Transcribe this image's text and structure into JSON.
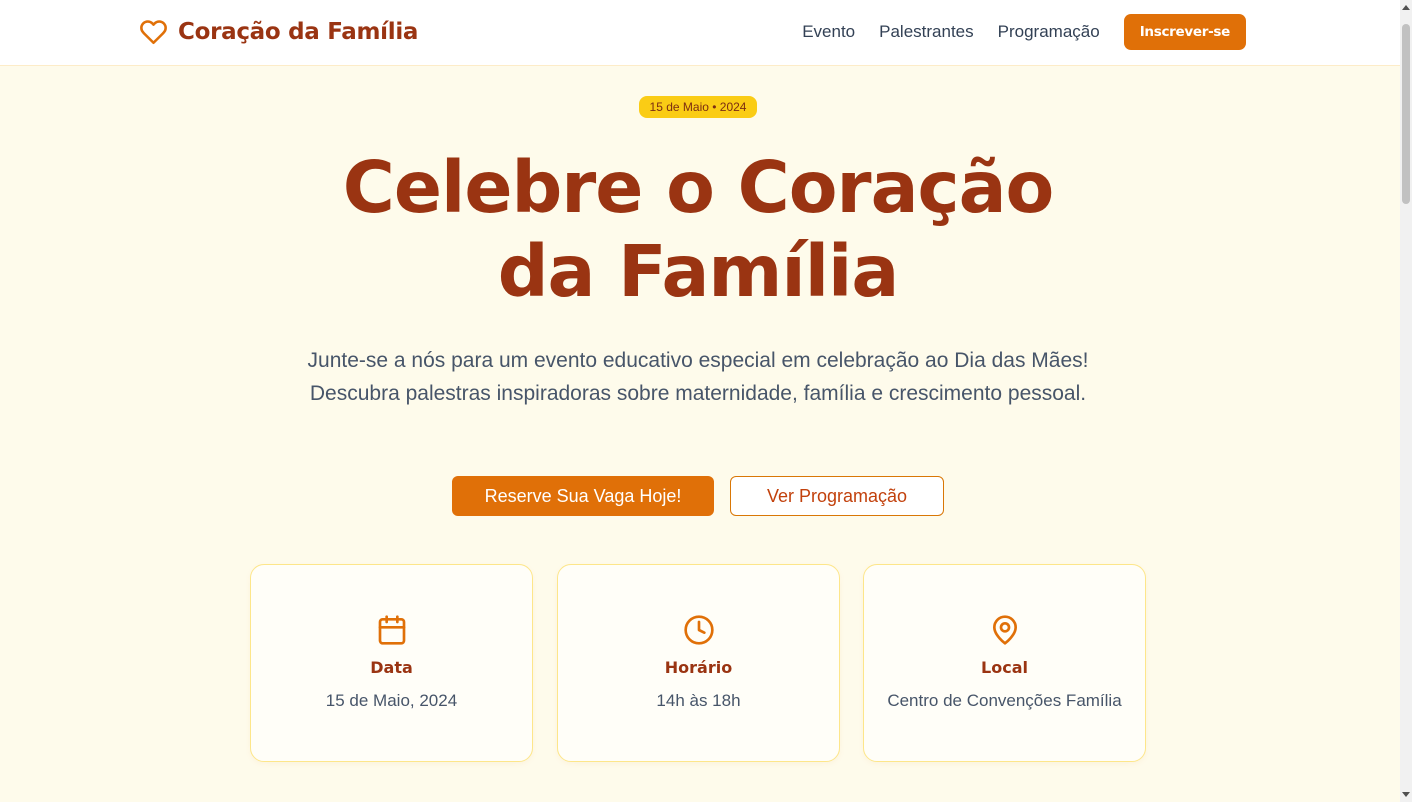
{
  "header": {
    "brand_name": "Coração da Família",
    "nav": [
      "Evento",
      "Palestrantes",
      "Programação"
    ],
    "cta_label": "Inscrever-se"
  },
  "hero": {
    "badge": "15 de Maio • 2024",
    "title_line1": "Celebre o Coração",
    "title_line2": "da Família",
    "subtitle": "Junte-se a nós para um evento educativo especial em celebração ao Dia das Mães! Descubra palestras inspiradoras sobre maternidade, família e crescimento pessoal.",
    "primary_button": "Reserve Sua Vaga Hoje!",
    "secondary_button": "Ver Programação"
  },
  "info_cards": [
    {
      "icon": "calendar-icon",
      "title": "Data",
      "value": "15 de Maio, 2024"
    },
    {
      "icon": "clock-icon",
      "title": "Horário",
      "value": "14h às 18h"
    },
    {
      "icon": "map-pin-icon",
      "title": "Local",
      "value": "Centro de Convenções Família"
    }
  ],
  "colors": {
    "brand_dark": "#9a3412",
    "accent": "#e07008",
    "badge": "#facc15",
    "background": "#fefbeb",
    "card_border": "#fde68a"
  }
}
